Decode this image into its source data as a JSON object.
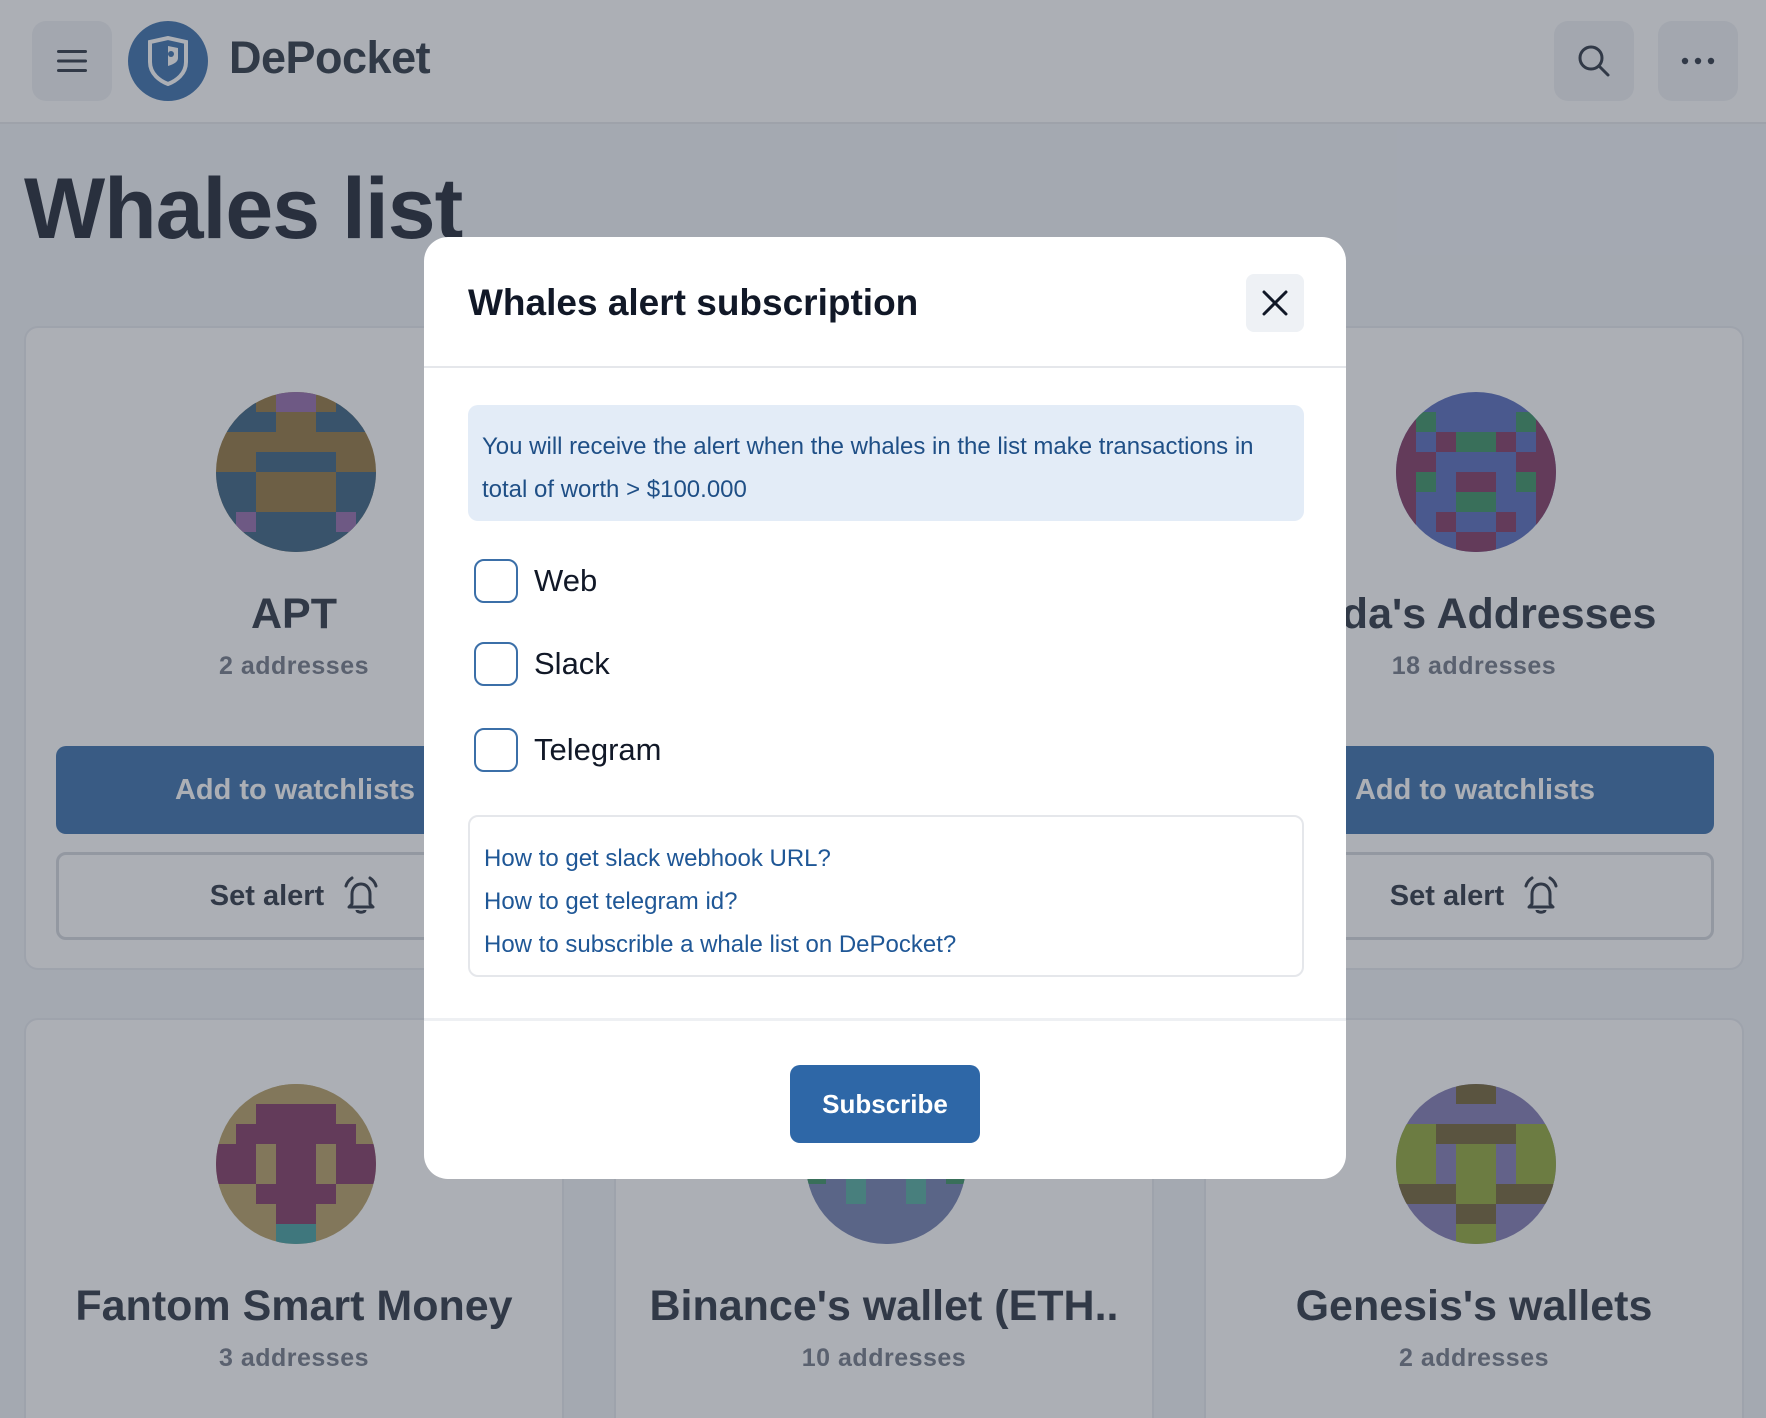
{
  "app": {
    "brand": "DePocket"
  },
  "page": {
    "title": "Whales list"
  },
  "cards": [
    {
      "name": "APT",
      "count": "2 addresses",
      "watch_label": "Add to watchlists",
      "alert_label": "Set alert"
    },
    {
      "name": "neda's Addresses",
      "count": "18 addresses",
      "watch_label": "Add to watchlists",
      "alert_label": "Set alert"
    },
    {
      "name": "Fantom Smart Money",
      "count": "3 addresses"
    },
    {
      "name": "Binance's wallet (ETH..",
      "count": "10 addresses"
    },
    {
      "name": "Genesis's wallets",
      "count": "2 addresses"
    }
  ],
  "modal": {
    "title": "Whales alert subscription",
    "info": "You will receive the alert when the whales in the list make transactions in total of worth > $100.000",
    "options": [
      {
        "label": "Web",
        "checked": false
      },
      {
        "label": "Slack",
        "checked": false
      },
      {
        "label": "Telegram",
        "checked": false
      }
    ],
    "help_links": [
      "How to get slack webhook URL?",
      "How to get telegram id?",
      "How to subscrible a whale list on DePocket?"
    ],
    "subscribe_label": "Subscribe"
  },
  "colors": {
    "primary": "#2e67a7",
    "info_bg": "#e3ecf7",
    "link": "#1f5796"
  }
}
